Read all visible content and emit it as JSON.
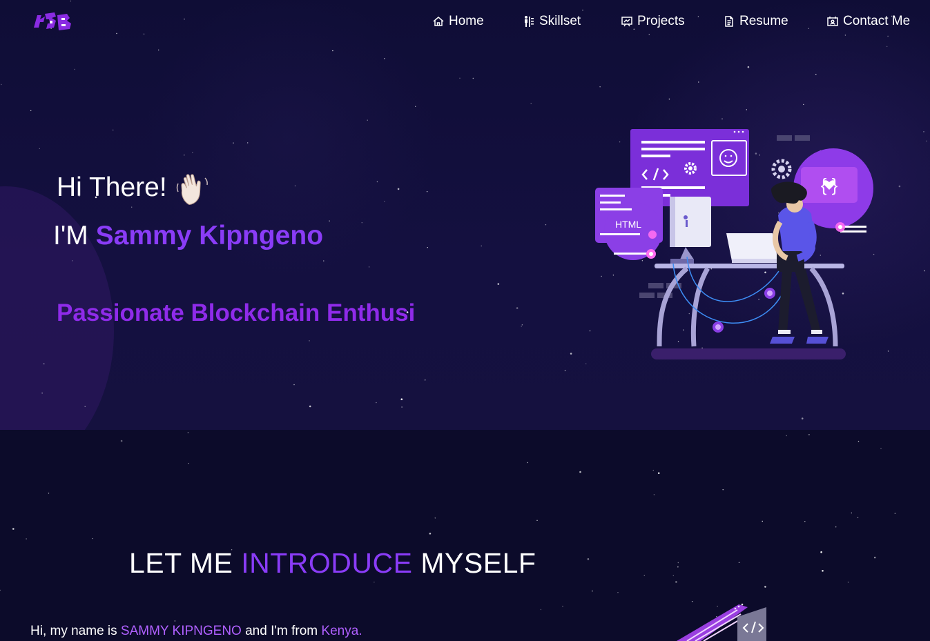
{
  "nav": {
    "logo": "SKB",
    "items": [
      {
        "label": "Home",
        "icon": "home-icon"
      },
      {
        "label": "Skillset",
        "icon": "skillset-icon"
      },
      {
        "label": "Projects",
        "icon": "projects-icon"
      },
      {
        "label": "Resume",
        "icon": "resume-icon"
      },
      {
        "label": "Contact Me",
        "icon": "contact-icon"
      }
    ]
  },
  "hero": {
    "greeting": "Hi There!",
    "wave_emoji": "👋🏻",
    "im_prefix": "I'M",
    "name": "Sammy Kipngeno",
    "typed_text": "Passionate Blockchain Enthusi",
    "illustration": {
      "html_label": "HTML"
    }
  },
  "intro": {
    "title_part1": "LET ME",
    "title_highlight": "INTRODUCE",
    "title_part2": "MYSELF",
    "text_part1": "Hi, my name is",
    "text_name": "SAMMY KIPNGENO",
    "text_part2": "and I'm from",
    "text_place": "Kenya."
  },
  "colors": {
    "accent": "#8a3cf7",
    "background": "#0c0b2a"
  }
}
